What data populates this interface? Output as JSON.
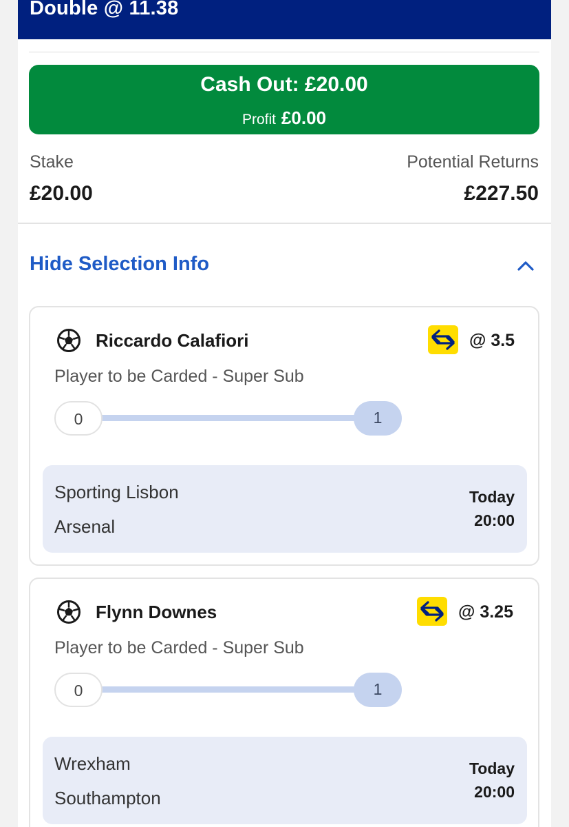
{
  "header": {
    "title": "Double @ 11.38"
  },
  "cashout": {
    "label": "Cash Out: £20.00",
    "profit_label": "Profit",
    "profit_value": "£0.00"
  },
  "summary": {
    "stake_label": "Stake",
    "stake_value": "£20.00",
    "returns_label": "Potential Returns",
    "returns_value": "£227.50"
  },
  "selection_toggle": {
    "label": "Hide Selection Info",
    "icon": "chevron-up-icon"
  },
  "colors": {
    "header": "#00207f",
    "cashout": "#028a3d",
    "link": "#1f5bc6",
    "badge": "#ffdd00",
    "fixture_bg": "#e8ecf7"
  },
  "selections": [
    {
      "player": "Riccardo Calafiori",
      "odds": "@ 3.5",
      "market": "Player to be Carded - Super Sub",
      "progress": {
        "start": "0",
        "end": "1"
      },
      "fixture": {
        "home": "Sporting Lisbon",
        "away": "Arsenal",
        "day": "Today",
        "time": "20:00"
      }
    },
    {
      "player": "Flynn Downes",
      "odds": "@ 3.25",
      "market": "Player to be Carded - Super Sub",
      "progress": {
        "start": "0",
        "end": "1"
      },
      "fixture": {
        "home": "Wrexham",
        "away": "Southampton",
        "day": "Today",
        "time": "20:00"
      }
    }
  ]
}
